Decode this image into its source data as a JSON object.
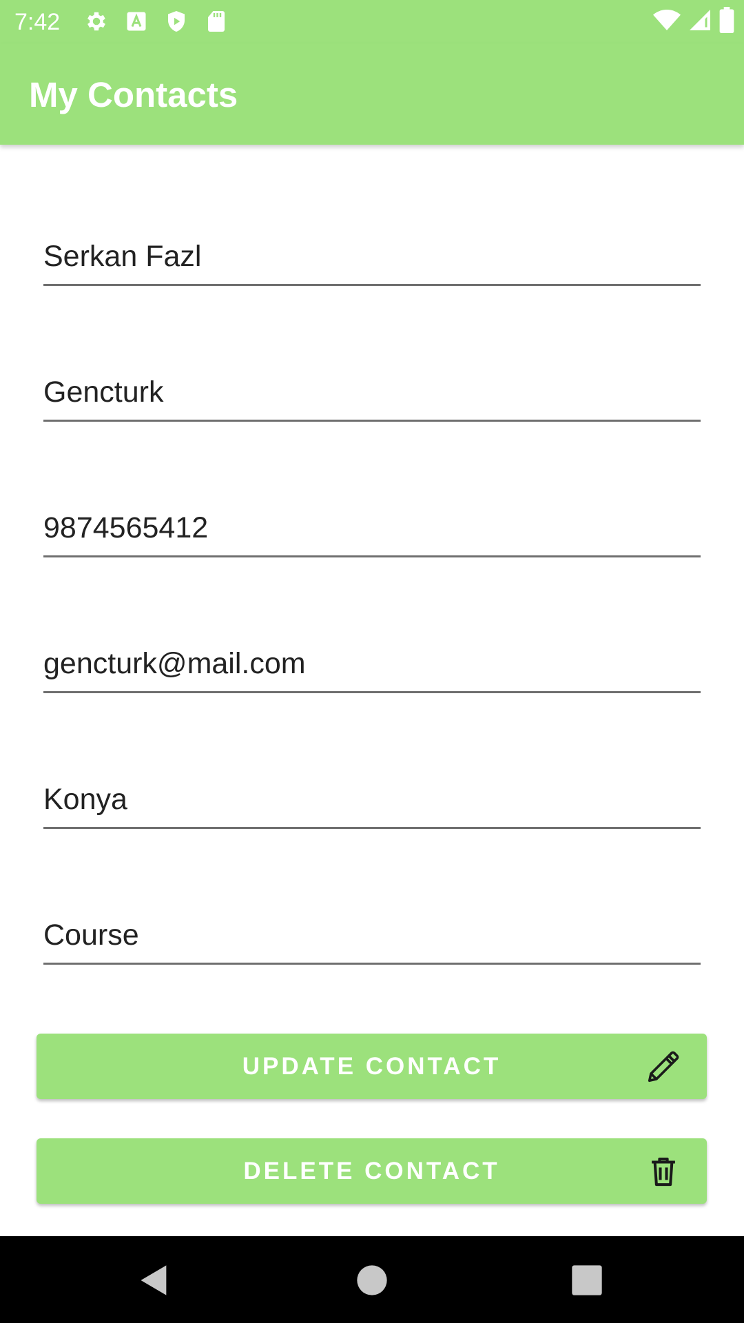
{
  "status_bar": {
    "time": "7:42",
    "left_icons": [
      "gear-icon",
      "font-a-icon",
      "shield-play-icon",
      "sd-card-icon"
    ],
    "right_icons": [
      "wifi-icon",
      "cell-signal-icon",
      "battery-icon"
    ]
  },
  "app_bar": {
    "title": "My Contacts",
    "background": "#9ce17c"
  },
  "form": {
    "fields": [
      {
        "name": "first-name-field",
        "value": "Serkan Fazl"
      },
      {
        "name": "last-name-field",
        "value": "Gencturk"
      },
      {
        "name": "phone-field",
        "value": "9874565412"
      },
      {
        "name": "email-field",
        "value": "gencturk@mail.com"
      },
      {
        "name": "city-field",
        "value": "Konya"
      },
      {
        "name": "group-field",
        "value": "Course"
      }
    ]
  },
  "buttons": {
    "update_label": "UPDATE CONTACT",
    "update_icon": "pencil-icon",
    "delete_label": "DELETE CONTACT",
    "delete_icon": "trash-icon"
  },
  "nav_bar": {
    "icons": [
      "back-icon",
      "home-icon",
      "recents-icon"
    ]
  }
}
